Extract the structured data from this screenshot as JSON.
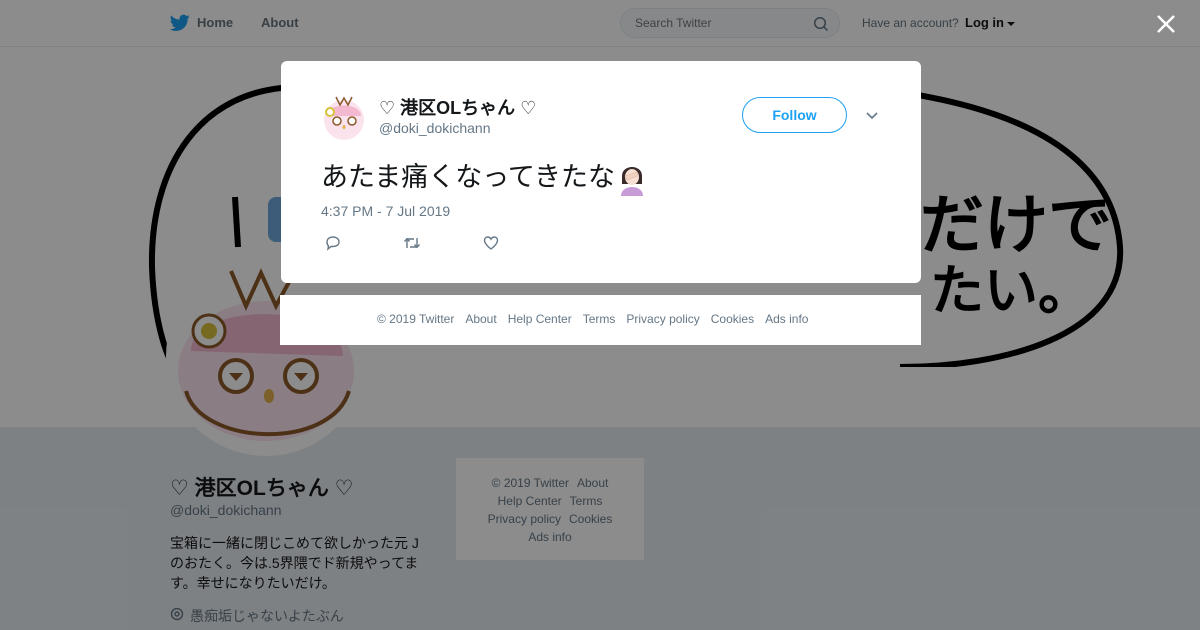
{
  "nav": {
    "home_label": "Home",
    "about_label": "About",
    "search_placeholder": "Search Twitter",
    "have_account": "Have an account?",
    "login_label": "Log in"
  },
  "profile": {
    "name": "♡ 港区OLちゃん ♡",
    "handle": "@doki_dokichann",
    "bio": "宝箱に一緒に閉じこめて欲しかった元 J のおたく。今は.5界隈でド新規やってます。幸せになりたいだけ。",
    "location": "愚痴垢じゃないよたぶん",
    "footer_links": [
      "© 2019 Twitter",
      "About",
      "Help Center",
      "Terms",
      "Privacy policy",
      "Cookies",
      "Ads info"
    ]
  },
  "tweet": {
    "author_name": "♡ 港区OLちゃん ♡",
    "author_handle": "@doki_dokichann",
    "follow_label": "Follow",
    "text": "あたま痛くなってきたな",
    "emoji": "woman-facepalming-emoji",
    "timestamp": "4:37 PM - 7 Jul 2019"
  },
  "modal_footer": {
    "links": [
      "© 2019 Twitter",
      "About",
      "Help Center",
      "Terms",
      "Privacy policy",
      "Cookies",
      "Ads info"
    ]
  },
  "colors": {
    "accent": "#1da1f2",
    "secondary_text": "#657786",
    "overlay": "rgba(0,0,0,0.45)"
  }
}
